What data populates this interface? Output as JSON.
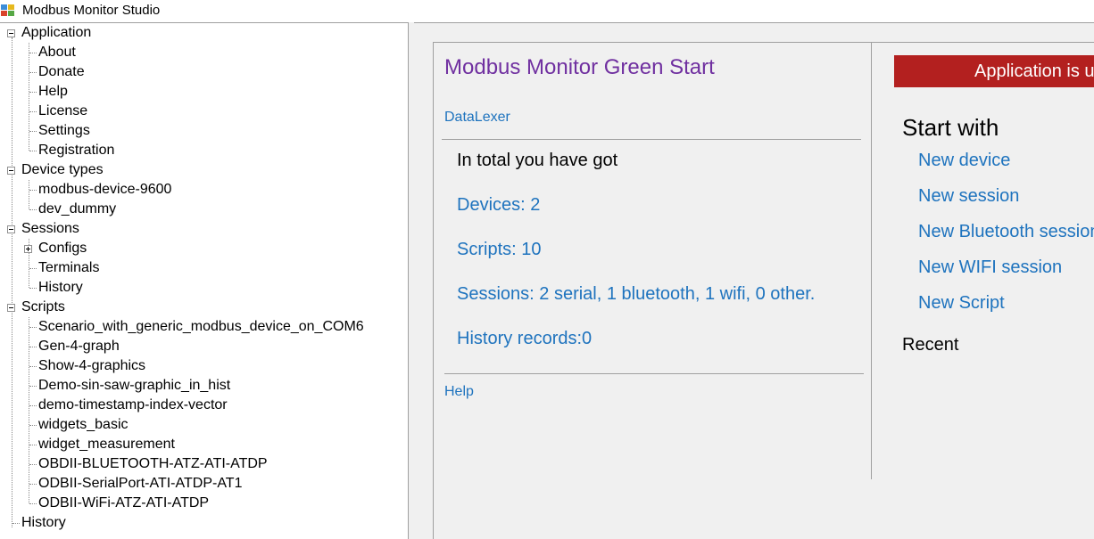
{
  "window": {
    "title": "Modbus Monitor Studio"
  },
  "tree": {
    "application": {
      "label": "Application",
      "children": [
        "About",
        "Donate",
        "Help",
        "License",
        "Settings",
        "Registration"
      ]
    },
    "device_types": {
      "label": "Device types",
      "children": [
        "modbus-device-9600",
        "dev_dummy"
      ]
    },
    "sessions": {
      "label": "Sessions",
      "children": [
        "Configs",
        "Terminals",
        "History"
      ]
    },
    "scripts": {
      "label": "Scripts",
      "children": [
        "Scenario_with_generic_modbus_device_on_COM6",
        "Gen-4-graph",
        "Show-4-graphics",
        "Demo-sin-saw-graphic_in_hist",
        "demo-timestamp-index-vector",
        "widgets_basic",
        "widget_measurement",
        "OBDII-BLUETOOTH-ATZ-ATI-ATDP",
        "ODBII-SerialPort-ATI-ATDP-AT1",
        "ODBII-WiFi-ATZ-ATI-ATDP"
      ]
    },
    "history": {
      "label": "History"
    }
  },
  "start_page": {
    "title": "Modbus Monitor Green Start",
    "datalexer_link": "DataLexer",
    "total_label": "In total you have got",
    "stats": {
      "devices": "Devices: 2",
      "scripts": "Scripts: 10",
      "sessions": "Sessions: 2 serial, 1 bluetooth, 1 wifi, 0 other.",
      "history": "History records:0"
    },
    "help_link": "Help",
    "banner": {
      "text": "Application is unregistered",
      "color": "#b3201f"
    },
    "start_with": {
      "heading": "Start with",
      "links": [
        "New device",
        "New session",
        "New Bluetooth session",
        "New WIFI session",
        "New Script"
      ]
    },
    "recent_heading": "Recent"
  },
  "colors": {
    "link": "#1e73be",
    "title": "#7030a0",
    "panel_bg": "#f0f0f0"
  }
}
